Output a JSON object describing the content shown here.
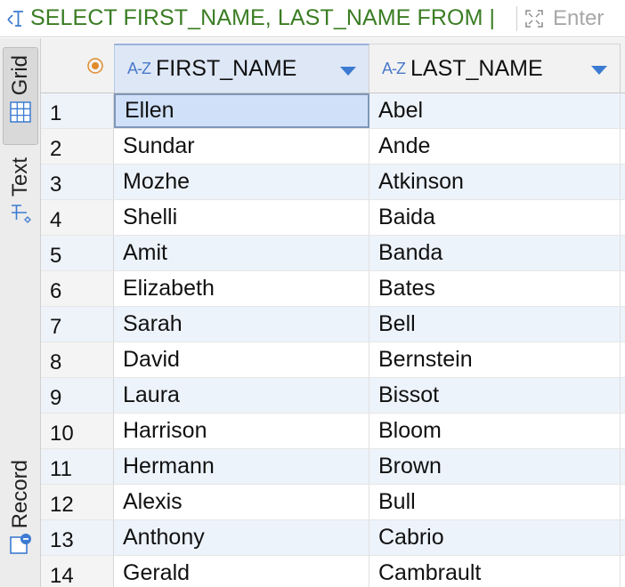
{
  "query": {
    "text": "SELECT FIRST_NAME, LAST_NAME FROM |",
    "filter_placeholder": "Enter",
    "query_icon": "sql-text-icon",
    "expand_icon": "expand-icon"
  },
  "side_tabs": [
    {
      "label": "Grid",
      "icon": "grid-icon",
      "active": true
    },
    {
      "label": "Text",
      "icon": "text-mode-icon",
      "active": false
    },
    {
      "label": "Record",
      "icon": "record-icon",
      "active": false
    }
  ],
  "columns": [
    {
      "type_badge": "A-Z",
      "name": "FIRST_NAME",
      "sorted": true
    },
    {
      "type_badge": "A-Z",
      "name": "LAST_NAME",
      "sorted": false
    }
  ],
  "rows": [
    {
      "num": "1",
      "first": "Ellen",
      "last": "Abel"
    },
    {
      "num": "2",
      "first": "Sundar",
      "last": "Ande"
    },
    {
      "num": "3",
      "first": "Mozhe",
      "last": "Atkinson"
    },
    {
      "num": "4",
      "first": "Shelli",
      "last": "Baida"
    },
    {
      "num": "5",
      "first": "Amit",
      "last": "Banda"
    },
    {
      "num": "6",
      "first": "Elizabeth",
      "last": "Bates"
    },
    {
      "num": "7",
      "first": "Sarah",
      "last": "Bell"
    },
    {
      "num": "8",
      "first": "David",
      "last": "Bernstein"
    },
    {
      "num": "9",
      "first": "Laura",
      "last": "Bissot"
    },
    {
      "num": "10",
      "first": "Harrison",
      "last": "Bloom"
    },
    {
      "num": "11",
      "first": "Hermann",
      "last": "Brown"
    },
    {
      "num": "12",
      "first": "Alexis",
      "last": "Bull"
    },
    {
      "num": "13",
      "first": "Anthony",
      "last": "Cabrio"
    },
    {
      "num": "14",
      "first": "Gerald",
      "last": "Cambrault"
    }
  ],
  "colors": {
    "query_text": "#3a7d23",
    "accent": "#3c7bd1",
    "row_alt": "#edf3fb",
    "selected_cell": "#cfe0f8",
    "header_indicator": "#e08a2c"
  }
}
